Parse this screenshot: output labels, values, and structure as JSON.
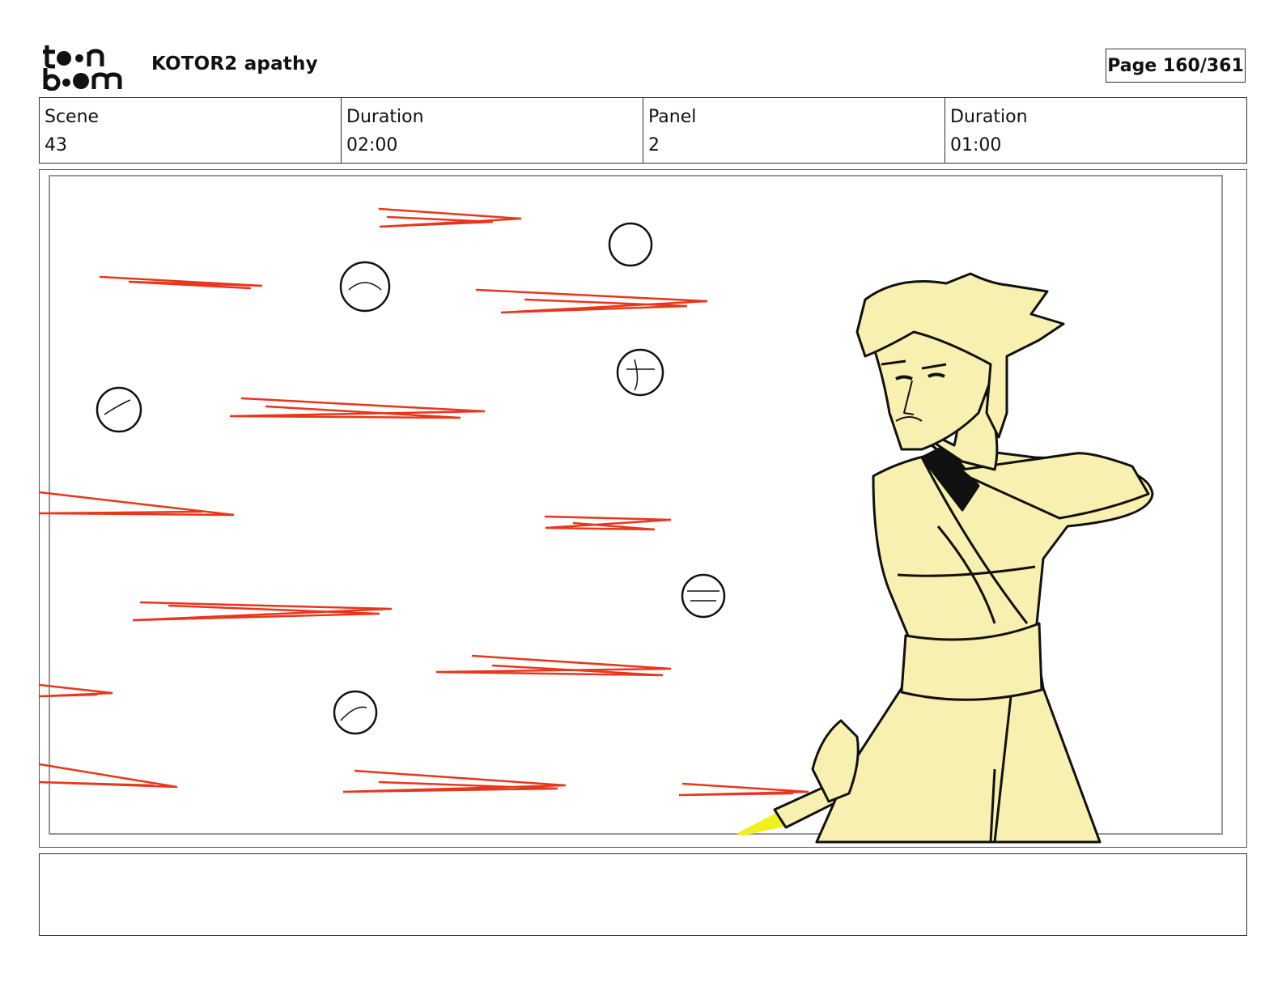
{
  "header": {
    "project_title": "KOTOR2 apathy",
    "page_label": "Page 160/361"
  },
  "info": [
    {
      "label": "Scene",
      "value": "43"
    },
    {
      "label": "Duration",
      "value": "02:00"
    },
    {
      "label": "Panel",
      "value": "2"
    },
    {
      "label": "Duration",
      "value": "01:00"
    }
  ],
  "colors": {
    "streak": "#e8361c",
    "figure_fill": "#f8f0b0",
    "lightsaber": "#f0f020",
    "ink": "#111111"
  },
  "notes": ""
}
